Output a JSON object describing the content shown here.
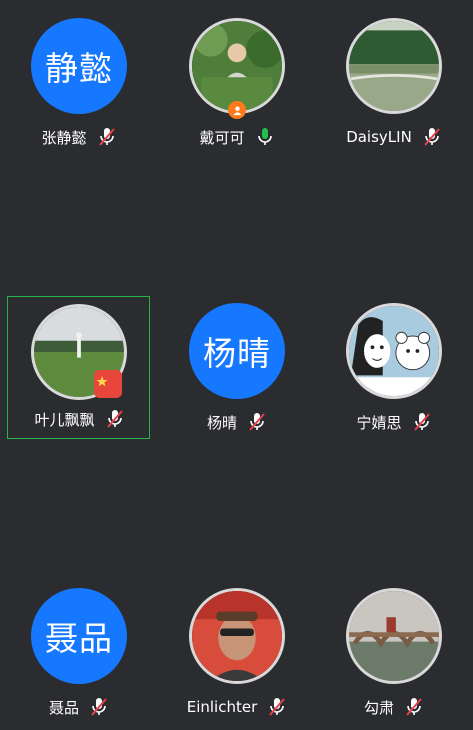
{
  "participants": [
    {
      "name": "张静懿",
      "avatar_text": "静懿",
      "muted": true
    },
    {
      "name": "戴可可",
      "avatar_text": "",
      "muted": false,
      "host": true
    },
    {
      "name": "DaisyLIN",
      "avatar_text": "",
      "muted": true
    },
    {
      "name": "叶儿飘飘",
      "avatar_text": "",
      "muted": true,
      "selected": true
    },
    {
      "name": "杨晴",
      "avatar_text": "杨晴",
      "muted": true
    },
    {
      "name": "宁婧思",
      "avatar_text": "",
      "muted": true
    },
    {
      "name": "聂品",
      "avatar_text": "聂品",
      "muted": true
    },
    {
      "name": "Einlichter",
      "avatar_text": "",
      "muted": true
    },
    {
      "name": "勾肃",
      "avatar_text": "",
      "muted": true
    }
  ],
  "colors": {
    "background": "#2b2c2f",
    "avatar_blue": "#1677ff",
    "selection_green": "#27b24a",
    "mic_active": "#22c04a",
    "mic_muted_slash": "#e5414d"
  },
  "icons": {
    "mic_muted": "mic-muted-icon",
    "mic_active": "mic-active-icon",
    "host": "host-badge-icon"
  }
}
